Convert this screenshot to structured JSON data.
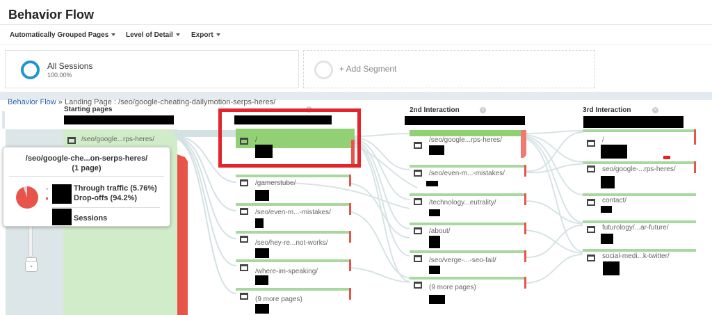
{
  "header": {
    "title": "Behavior Flow"
  },
  "toolbar": {
    "grouped_label": "Automatically Grouped Pages",
    "detail_label": "Level of Detail",
    "export_label": "Export"
  },
  "segments": {
    "active": {
      "name": "All Sessions",
      "percent": "100.00%",
      "color": "#1e94d2"
    },
    "add_label": "+ Add Segment"
  },
  "breadcrumb": {
    "root": "Behavior Flow",
    "separator": "»",
    "rest": "Landing Page : /seo/google-cheating-dailymotion-serps-heres/"
  },
  "columns": {
    "starting": {
      "label": "Starting pages"
    },
    "second": {
      "label": "2nd Interaction"
    },
    "third": {
      "label": "3rd Interaction"
    }
  },
  "starting_node": {
    "label": "/seo/google...rps-heres/"
  },
  "first_interaction_nodes": [
    {
      "label": "/"
    },
    {
      "label": "/gamerstube/"
    },
    {
      "label": "/seo/even-m...-mistakes/"
    },
    {
      "label": "/seo/hey-re...not-works/"
    },
    {
      "label": "/where-im-speaking/"
    },
    {
      "label": "(9 more pages)"
    }
  ],
  "second_interaction_nodes": [
    {
      "label": "/seo/google...rps-heres/"
    },
    {
      "label": "/seo/even-m...-mistakes/"
    },
    {
      "label": "/technology...eutrality/"
    },
    {
      "label": "/about/"
    },
    {
      "label": "/seo/verge-...-seo-fail/"
    },
    {
      "label": "(9 more pages)"
    }
  ],
  "third_interaction_nodes": [
    {
      "label": "/"
    },
    {
      "label": "seo/google-...rps-heres/"
    },
    {
      "label": "contact/"
    },
    {
      "label": "futurology/...ar-future/"
    },
    {
      "label": "social-medi...k-twitter/"
    }
  ],
  "popup": {
    "title": "/seo/google-che...on-serps-heres/",
    "subtitle": "(1 page)",
    "through_traffic": "Through traffic (5.76%)",
    "drop_offs": "Drop-offs (94.2%)",
    "sessions_label": "Sessions",
    "through_pct": 5.76,
    "dropoff_pct": 94.2
  },
  "zoom": {
    "minus_label": "-"
  },
  "colors": {
    "accent": "#1e94d2",
    "node_green": "#a9d7a0",
    "dropoff_red": "#e8544a",
    "highlight_red": "#e3242b",
    "link_blue": "#2563a8"
  }
}
